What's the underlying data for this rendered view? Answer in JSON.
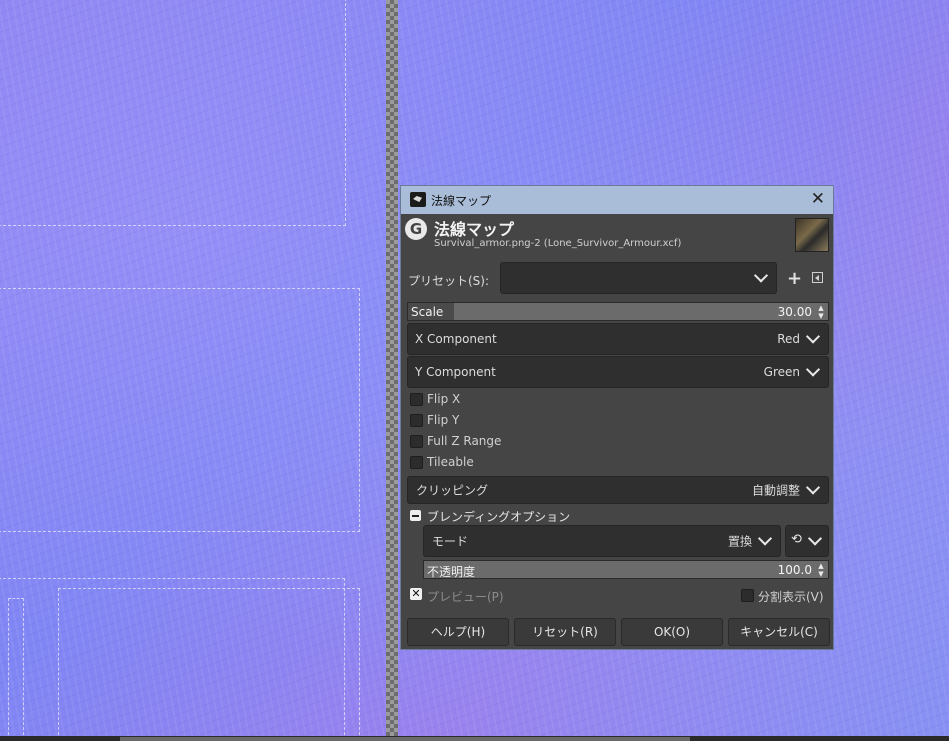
{
  "dialog": {
    "title": "法線マップ",
    "header_title": "法線マップ",
    "header_subtitle": "Survival_armor.png-2 (Lone_Survivor_Armour.xcf)",
    "close_glyph": "✕",
    "logo_glyph": "G",
    "titlebar_color": "#a9bcd8"
  },
  "preset": {
    "label": "プリセット(S):",
    "value": "",
    "add_glyph": "+"
  },
  "scale": {
    "label": "Scale",
    "value": "30.00",
    "fill_fraction": 0.11
  },
  "x_component": {
    "label": "X Component",
    "value": "Red"
  },
  "y_component": {
    "label": "Y Component",
    "value": "Green"
  },
  "options": [
    {
      "label": "Flip X",
      "checked": false
    },
    {
      "label": "Flip Y",
      "checked": false
    },
    {
      "label": "Full Z Range",
      "checked": false
    },
    {
      "label": "Tileable",
      "checked": false
    }
  ],
  "clipping": {
    "label": "クリッピング",
    "value": "自動調整"
  },
  "blending": {
    "label": "ブレンディングオプション",
    "mode_label": "モード",
    "mode_value": "置換",
    "rotate_glyph": "⟲",
    "opacity_label": "不透明度",
    "opacity_value": "100.0"
  },
  "preview": {
    "label": "プレビュー(P)",
    "checked": true,
    "check_glyph": "✕"
  },
  "split_view": {
    "label": "分割表示(V)",
    "checked": false
  },
  "buttons": {
    "help": "ヘルプ(H)",
    "reset": "リセット(R)",
    "ok": "OK(O)",
    "cancel": "キャンセル(C)"
  },
  "spin_arrows": {
    "up": "▲",
    "down": "▼"
  }
}
